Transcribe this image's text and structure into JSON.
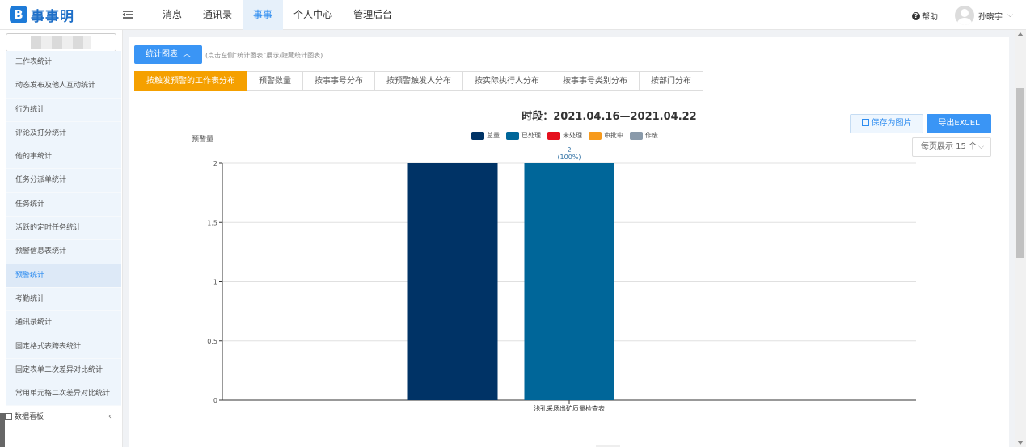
{
  "app": {
    "logo_mark": "B",
    "name": "事事明"
  },
  "nav": {
    "items": [
      {
        "label": "消息"
      },
      {
        "label": "通讯录"
      },
      {
        "label": "事事"
      },
      {
        "label": "个人中心"
      },
      {
        "label": "管理后台"
      }
    ],
    "active_index": 2
  },
  "header": {
    "help_label": "帮助",
    "user_name": "孙晓宇"
  },
  "sidebar": {
    "items": [
      {
        "label": "工作表统计"
      },
      {
        "label": "动态发布及他人互动统计"
      },
      {
        "label": "行为统计"
      },
      {
        "label": "评论及打分统计"
      },
      {
        "label": "他的事统计"
      },
      {
        "label": "任务分派单统计"
      },
      {
        "label": "任务统计"
      },
      {
        "label": "活跃的定时任务统计"
      },
      {
        "label": "预警信息表统计"
      },
      {
        "label": "预警统计"
      },
      {
        "label": "考勤统计"
      },
      {
        "label": "通讯录统计"
      },
      {
        "label": "固定格式表跨表统计"
      },
      {
        "label": "固定表单二次差异对比统计"
      },
      {
        "label": "常用单元格二次差异对比统计"
      }
    ],
    "active_index": 9,
    "footer_label": "数据看板"
  },
  "toolbar": {
    "toggle_label": "统计图表",
    "hint": "(点击左侧“统计图表”展示/隐藏统计图表)",
    "save_label": "保存为图片",
    "export_label": "导出EXCEL",
    "page_size_label": "每页展示 15 个"
  },
  "tabs": {
    "items": [
      {
        "label": "按触发预警的工作表分布"
      },
      {
        "label": "预警数量"
      },
      {
        "label": "按事事号分布"
      },
      {
        "label": "按预警触发人分布"
      },
      {
        "label": "按实际执行人分布"
      },
      {
        "label": "按事事号类别分布"
      },
      {
        "label": "按部门分布"
      }
    ],
    "active_index": 0
  },
  "colors": {
    "accent": "#3a95f5",
    "active_tab": "#f5a000"
  },
  "chart_data": {
    "type": "bar",
    "title": "时段：2021.04.16—2021.04.22",
    "ylabel": "预警量",
    "xlabel": "",
    "categories": [
      "浅孔采场出矿质量检查表"
    ],
    "series": [
      {
        "name": "总量",
        "color": "#003366",
        "values": [
          2
        ]
      },
      {
        "name": "已处理",
        "color": "#006699",
        "values": [
          2
        ],
        "label": "2",
        "label_sub": "(100%)"
      },
      {
        "name": "未处理",
        "color": "#e5101d",
        "values": [
          0
        ]
      },
      {
        "name": "审批中",
        "color": "#f79a1c",
        "values": [
          0
        ]
      },
      {
        "name": "作废",
        "color": "#8a9aaa",
        "values": [
          0
        ]
      }
    ],
    "ylim": [
      0,
      2
    ],
    "yticks": [
      "0",
      "0.5",
      "1",
      "1.5",
      "2"
    ],
    "grid": true,
    "legend_position": "top-center"
  }
}
